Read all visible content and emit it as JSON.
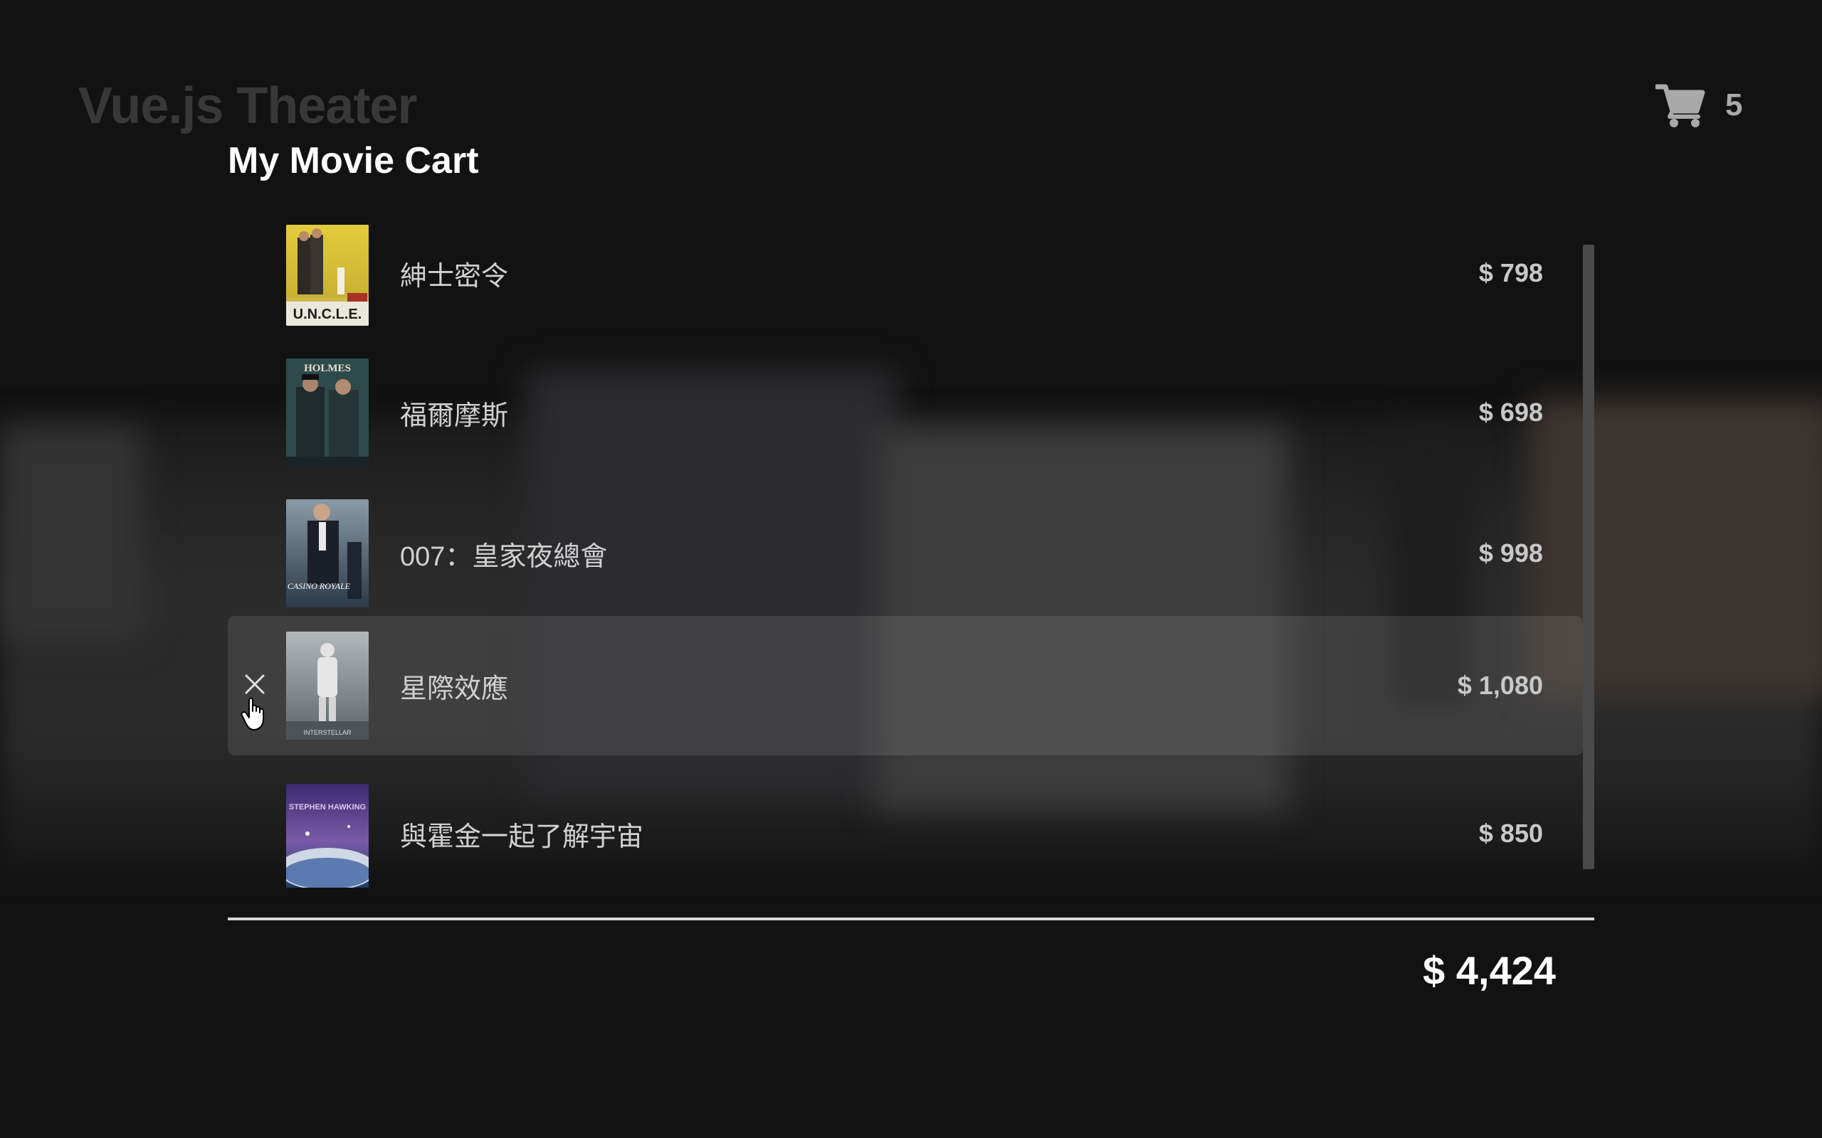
{
  "app": {
    "title": "Vue.js Theater"
  },
  "cart": {
    "count": "5",
    "icon": "shopping-cart-icon"
  },
  "dialog": {
    "title": "My Movie Cart",
    "items": [
      {
        "name": "紳士密令",
        "price": "$ 798",
        "poster": "the-man-from-uncle-poster",
        "poster_text": "U.N.C.L.E."
      },
      {
        "name": "福爾摩斯",
        "price": "$ 698",
        "poster": "sherlock-holmes-poster",
        "poster_text": "HOLMES"
      },
      {
        "name": "007：皇家夜總會",
        "price": "$ 998",
        "poster": "casino-royale-poster",
        "poster_text": "CASINO ROYALE"
      },
      {
        "name": "星際效應",
        "price": "$ 1,080",
        "poster": "interstellar-poster",
        "poster_text": "INTERSTELLAR"
      },
      {
        "name": "與霍金一起了解宇宙",
        "price": "$ 850",
        "poster": "into-the-universe-poster",
        "poster_text": "STEPHEN HAWKING"
      }
    ],
    "total": "$ 4,424"
  },
  "colors": {
    "background": "#121212",
    "hover_row": "rgba(255,255,255,0.10)",
    "scrollbar": "#4a4a4a",
    "divider": "#d6d6d6"
  }
}
